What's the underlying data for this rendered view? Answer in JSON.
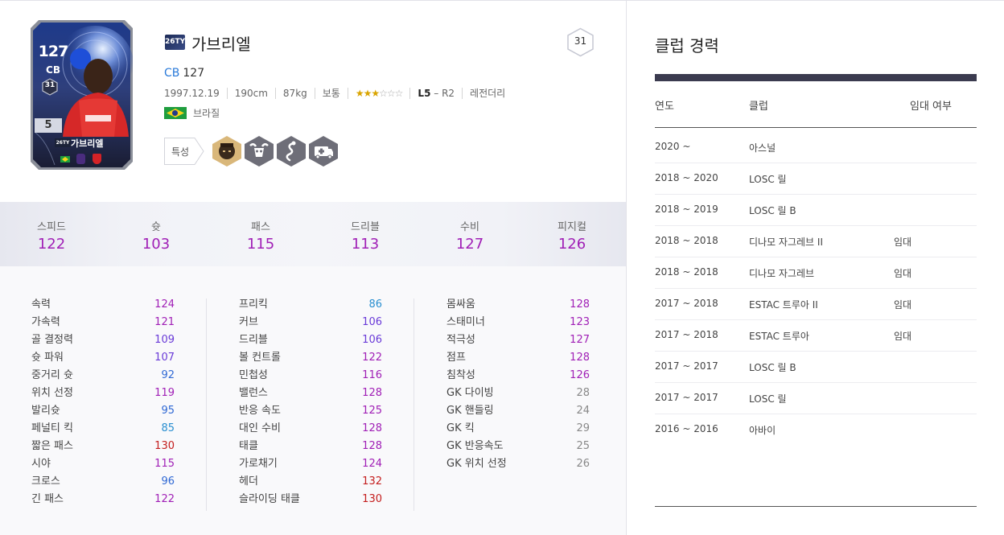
{
  "card": {
    "ovr": "127",
    "position": "CB",
    "badge_number": "31",
    "grade": "5",
    "season": "26TY",
    "name": "가브리엘"
  },
  "player": {
    "season": "26TY",
    "name": "가브리엘",
    "number": "31",
    "position": "CB",
    "ovr": "127",
    "birth": "1997.12.19",
    "height": "190cm",
    "weight": "87kg",
    "build": "보통",
    "stars_full": "★★★",
    "stars_empty": "☆☆☆",
    "foot_main": "L5",
    "foot_sep": " – ",
    "foot_sub": "R2",
    "tag": "레전더리",
    "nation": "브라질"
  },
  "traits": {
    "label": "특성",
    "icons": [
      "samurai-face-icon",
      "ram-skull-icon",
      "snake-icon",
      "ambulance-icon"
    ]
  },
  "summary": [
    {
      "label": "스피드",
      "value": "122"
    },
    {
      "label": "슛",
      "value": "103"
    },
    {
      "label": "패스",
      "value": "115"
    },
    {
      "label": "드리블",
      "value": "113"
    },
    {
      "label": "수비",
      "value": "127"
    },
    {
      "label": "피지컬",
      "value": "126"
    }
  ],
  "stats": {
    "col1": [
      {
        "label": "속력",
        "value": "124",
        "color": "#a01fb6"
      },
      {
        "label": "가속력",
        "value": "121",
        "color": "#a01fb6"
      },
      {
        "label": "골 결정력",
        "value": "109",
        "color": "#6a3bd8"
      },
      {
        "label": "슛 파워",
        "value": "107",
        "color": "#6a3bd8"
      },
      {
        "label": "중거리 슛",
        "value": "92",
        "color": "#3069d4"
      },
      {
        "label": "위치 선정",
        "value": "119",
        "color": "#a01fb6"
      },
      {
        "label": "발리슛",
        "value": "95",
        "color": "#3069d4"
      },
      {
        "label": "페널티 킥",
        "value": "85",
        "color": "#2a8fd0"
      },
      {
        "label": "짧은 패스",
        "value": "130",
        "color": "#c41e1e"
      },
      {
        "label": "시야",
        "value": "115",
        "color": "#a01fb6"
      },
      {
        "label": "크로스",
        "value": "96",
        "color": "#3069d4"
      },
      {
        "label": "긴 패스",
        "value": "122",
        "color": "#a01fb6"
      }
    ],
    "col2": [
      {
        "label": "프리킥",
        "value": "86",
        "color": "#2a8fd0"
      },
      {
        "label": "커브",
        "value": "106",
        "color": "#6a3bd8"
      },
      {
        "label": "드리블",
        "value": "106",
        "color": "#6a3bd8"
      },
      {
        "label": "볼 컨트롤",
        "value": "122",
        "color": "#a01fb6"
      },
      {
        "label": "민첩성",
        "value": "116",
        "color": "#a01fb6"
      },
      {
        "label": "밸런스",
        "value": "128",
        "color": "#a01fb6"
      },
      {
        "label": "반응 속도",
        "value": "125",
        "color": "#a01fb6"
      },
      {
        "label": "대인 수비",
        "value": "128",
        "color": "#a01fb6"
      },
      {
        "label": "태클",
        "value": "128",
        "color": "#a01fb6"
      },
      {
        "label": "가로채기",
        "value": "124",
        "color": "#a01fb6"
      },
      {
        "label": "헤더",
        "value": "132",
        "color": "#c41e1e"
      },
      {
        "label": "슬라이딩 태클",
        "value": "130",
        "color": "#c41e1e"
      }
    ],
    "col3": [
      {
        "label": "몸싸움",
        "value": "128",
        "color": "#a01fb6"
      },
      {
        "label": "스태미너",
        "value": "123",
        "color": "#a01fb6"
      },
      {
        "label": "적극성",
        "value": "127",
        "color": "#a01fb6"
      },
      {
        "label": "점프",
        "value": "128",
        "color": "#a01fb6"
      },
      {
        "label": "침착성",
        "value": "126",
        "color": "#a01fb6"
      },
      {
        "label": "GK 다이빙",
        "value": "28",
        "color": "#888888"
      },
      {
        "label": "GK 핸들링",
        "value": "24",
        "color": "#888888"
      },
      {
        "label": "GK 킥",
        "value": "29",
        "color": "#888888"
      },
      {
        "label": "GK 반응속도",
        "value": "25",
        "color": "#888888"
      },
      {
        "label": "GK 위치 선정",
        "value": "26",
        "color": "#888888"
      }
    ]
  },
  "club_history": {
    "title": "클럽 경력",
    "headers": {
      "year": "연도",
      "club": "클럽",
      "loan": "임대 여부"
    },
    "rows": [
      {
        "year": "2020 ~",
        "club": "아스널",
        "loan": ""
      },
      {
        "year": "2018 ~ 2020",
        "club": "LOSC 릴",
        "loan": ""
      },
      {
        "year": "2018 ~ 2019",
        "club": "LOSC 릴 B",
        "loan": ""
      },
      {
        "year": "2018 ~ 2018",
        "club": "디나모 자그레브 II",
        "loan": "임대"
      },
      {
        "year": "2018 ~ 2018",
        "club": "디나모 자그레브",
        "loan": "임대"
      },
      {
        "year": "2017 ~ 2018",
        "club": "ESTAC 트루아 II",
        "loan": "임대"
      },
      {
        "year": "2017 ~ 2018",
        "club": "ESTAC 트루아",
        "loan": "임대"
      },
      {
        "year": "2017 ~ 2017",
        "club": "LOSC 릴 B",
        "loan": ""
      },
      {
        "year": "2017 ~ 2017",
        "club": "LOSC 릴",
        "loan": ""
      },
      {
        "year": "2016 ~ 2016",
        "club": "아바이",
        "loan": ""
      }
    ]
  },
  "colors": {
    "summary_value": "#a01fb6",
    "position": "#2a7ad9",
    "stars": "#d9a400"
  }
}
